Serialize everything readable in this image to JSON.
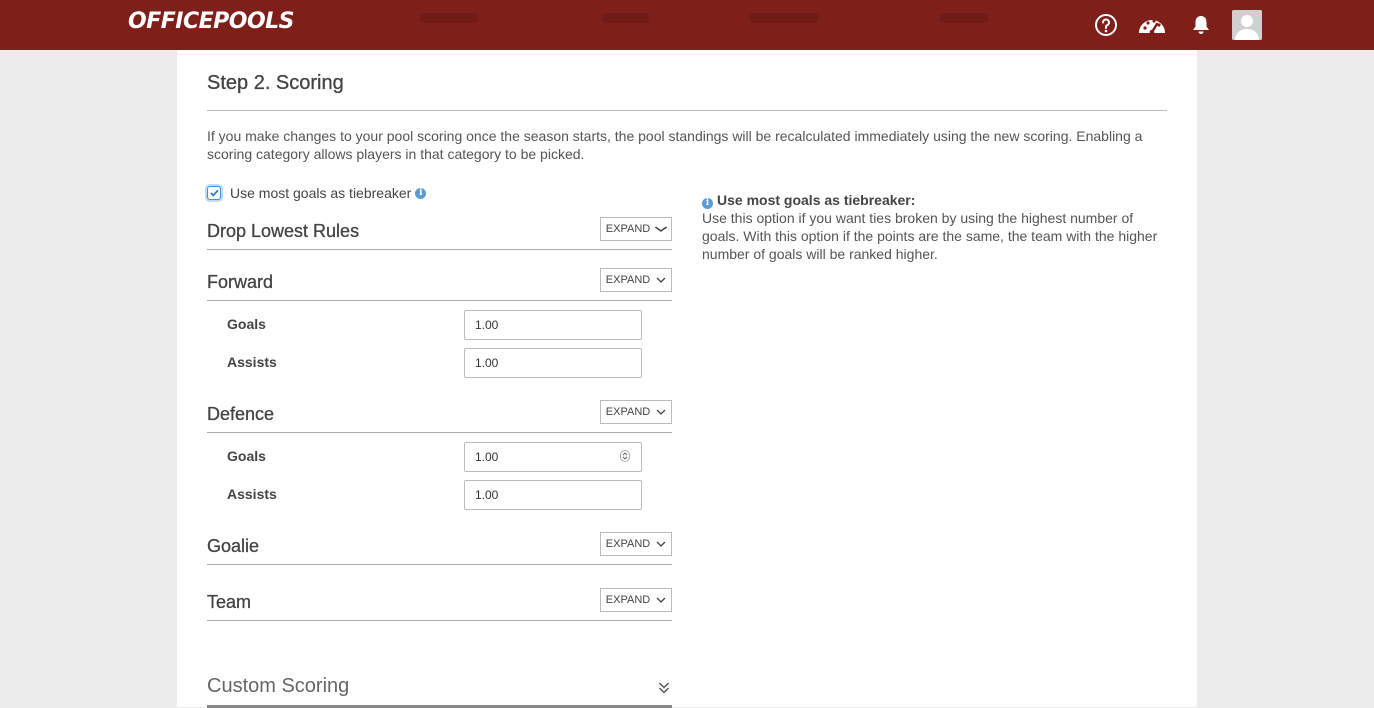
{
  "brand": {
    "logo_text": "OFFICEPOOLS",
    "bar_color": "#7e1f1a"
  },
  "header_icons": [
    "help-icon",
    "dashboard-icon",
    "bell-icon",
    "avatar"
  ],
  "page": {
    "title": "Step 2. Scoring",
    "intro": "If you make changes to your pool scoring once the season starts, the pool standings will be recalculated immediately using the new scoring. Enabling a scoring category allows players in that category to be picked.",
    "tiebreaker": {
      "label": "Use most goals as tiebreaker",
      "checked": true
    }
  },
  "help": {
    "title": "Use most goals as tiebreaker:",
    "body": "Use this option if you want ties broken by using the highest number of goals. With this option if the points are the same, the team with the higher number of goals will be ranked higher."
  },
  "expand_label": "EXPAND",
  "sections": {
    "drop_lowest": {
      "title": "Drop Lowest Rules"
    },
    "forward": {
      "title": "Forward",
      "goals_label": "Goals",
      "goals_value": "1.00",
      "assists_label": "Assists",
      "assists_value": "1.00"
    },
    "defence": {
      "title": "Defence",
      "goals_label": "Goals",
      "goals_value": "1.00",
      "assists_label": "Assists",
      "assists_value": "1.00"
    },
    "goalie": {
      "title": "Goalie"
    },
    "team": {
      "title": "Team"
    },
    "custom": {
      "title": "Custom Scoring"
    }
  }
}
